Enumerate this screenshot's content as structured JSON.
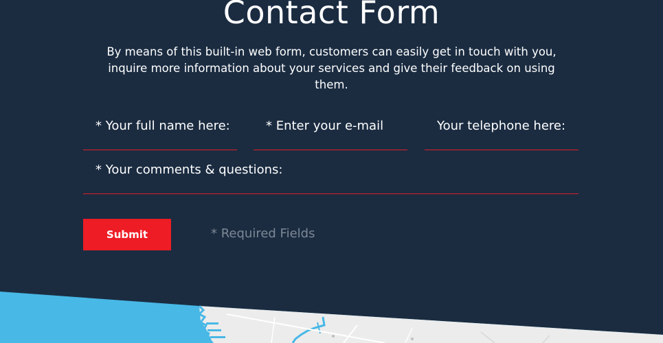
{
  "section": {
    "title": "Contact Form",
    "description": "By means of this built-in web form, customers can easily get in touch with you, inquire more information about your services and give their feedback on using them."
  },
  "form": {
    "name_placeholder": "* Your full name here:",
    "email_placeholder": "* Enter your e-mail",
    "phone_placeholder": "Your telephone here:",
    "comments_placeholder": "* Your comments & questions:",
    "submit_label": "Submit",
    "required_note": "* Required Fields"
  },
  "colors": {
    "background": "#1b2c41",
    "accent": "#ee1c25",
    "map_water": "#48b8e6",
    "map_land": "#eeeeee"
  }
}
